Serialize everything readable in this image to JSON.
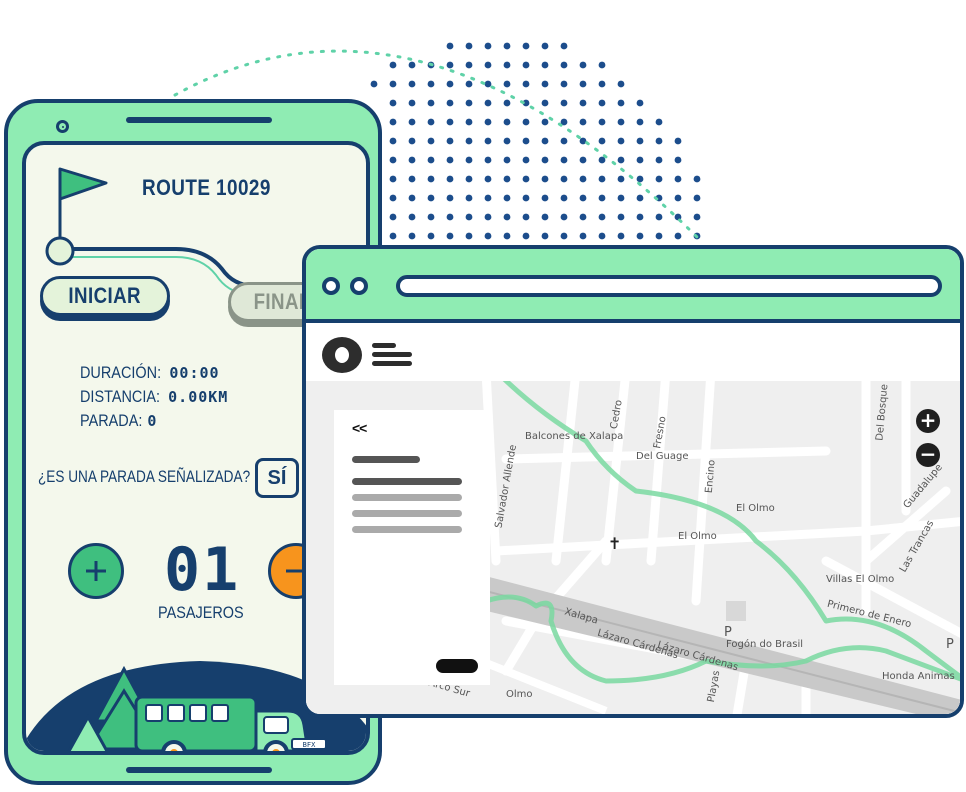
{
  "phone": {
    "route_title": "ROUTE 10029",
    "start_button": "INICIAR",
    "finish_button": "FINALIZ",
    "stats": [
      {
        "label": "DURACIÓN: ",
        "value": "00:00"
      },
      {
        "label": "DISTANCIA: ",
        "value": "0.00KM"
      },
      {
        "label": "PARADA: ",
        "value": "0"
      }
    ],
    "question": "¿ES UNA PARADA SEÑALIZADA?",
    "yes_button": "SÍ",
    "passenger_count": "01",
    "passenger_label": "PASAJEROS",
    "plate": "BFX"
  },
  "browser": {
    "panel": {
      "back_label": "<<"
    },
    "map": {
      "zoom_in": "+",
      "zoom_out": "−",
      "street_labels": [
        "Balcones de Xalapa",
        "Del Guage",
        "El Olmo",
        "El Olmo",
        "Villas El Olmo",
        "Primero de Enero",
        "Lázaro Cárdenas",
        "Lázaro Cárdenas",
        "Fogón do Brasil",
        "Honda Animas",
        "Arco Sur",
        "Cedro",
        "Fresno",
        "Encino",
        "Del Bosque",
        "Salvador Allende",
        "Las Trancas",
        "Guadalupe",
        "Playas",
        "Olmo",
        "Xalapa",
        "P",
        "P"
      ]
    }
  },
  "colors": {
    "navy": "#163f6d",
    "mint": "#8fecb3",
    "green": "#3fbf7f",
    "orange": "#f7941d",
    "route_line": "#7ad9a1"
  }
}
